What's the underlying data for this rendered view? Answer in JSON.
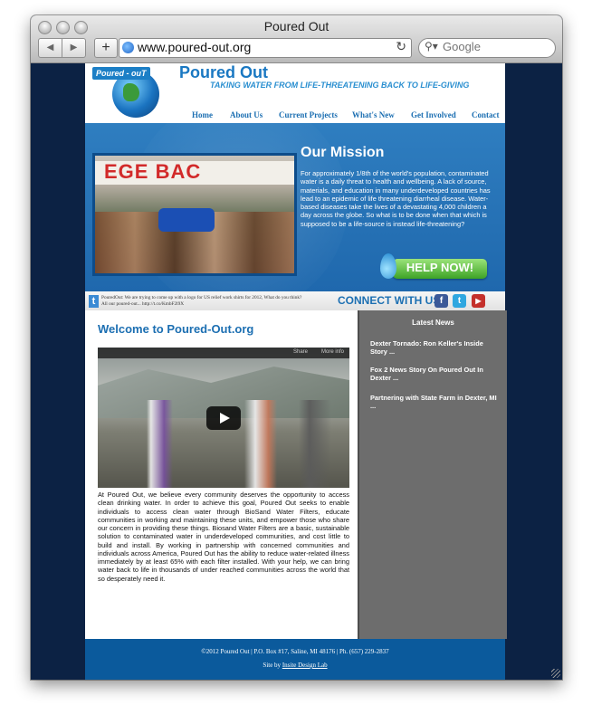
{
  "browser": {
    "window_title": "Poured Out",
    "url": "www.poured-out.org",
    "search_placeholder": "Google",
    "back_glyph": "◀",
    "forward_glyph": "▶",
    "add_glyph": "+",
    "reload_glyph": "↻"
  },
  "site": {
    "logo_badge": "Poured - ouT",
    "brand": "Poured Out",
    "tagline": "TAKING WATER FROM LIFE-THREATENING BACK TO LIFE-GIVING",
    "nav": [
      "Home",
      "About Us",
      "Current Projects",
      "What's New",
      "Get Involved",
      "Contact"
    ],
    "hero": {
      "image_banner_text": "EGE BAC",
      "mission_title": "Our Mission",
      "mission_text": "For approximately 1/8th of the world's population, contaminated water is a daily threat to health and wellbeing. A lack of source, materials, and education in many underdeveloped countries has lead to an epidemic of life threatening diarrheal disease. Water-based diseases take the lives of a devastating 4,000 children a day across the globe. So what is to be done when that which is supposed to be a life-source is instead life-threatening?",
      "help_button": "HELP NOW!"
    },
    "social": {
      "tweet": "PouredOut: We are trying to come up with a logo for US relief work shirts for 2012, What do you think? All our poured-out... http://t.co/KmbF2l9X",
      "connect_label": "CONNECT WITH US:",
      "icons": [
        {
          "name": "facebook-icon",
          "glyph": "f",
          "color": "#3b5998"
        },
        {
          "name": "twitter-icon",
          "glyph": "t",
          "color": "#2fa7e0"
        },
        {
          "name": "youtube-icon",
          "glyph": "▶",
          "color": "#c4302b"
        }
      ]
    },
    "welcome_title": "Welcome to Poured-Out.org",
    "video": {
      "share_label": "Share",
      "more_info_label": "More info"
    },
    "body_text": "At Poured Out, we believe every community deserves the opportunity to access clean drinking water. In order to achieve this goal, Poured Out seeks to enable individuals to access clean water through BioSand Water Filters, educate communities in working and maintaining these units, and empower those who share our concern in providing these things. Biosand Water Filters are a basic, sustainable solution to contaminated water in underdeveloped communities, and cost little to build and install. By working in partnership with concerned communities and individuals across America, Poured Out has the ability to reduce water-related illness immediately by at least 65% with each filter installed. With your help, we can bring water back to life in thousands of under reached communities across the world that so desperately need it.",
    "latest_news": {
      "title": "Latest News",
      "items": [
        "Dexter Tornado: Ron Keller's Inside Story ...",
        "Fox 2 News Story On Poured Out In Dexter ...",
        "Partnering with State Farm in Dexter, MI ..."
      ]
    },
    "footer": {
      "line1": "©2012 Poured Out | P.O. Box #17, Saline, MI 48176 | Ph. (657) 229-2837",
      "site_by": "Site by ",
      "designer_link": "Insite Design Lab"
    }
  }
}
